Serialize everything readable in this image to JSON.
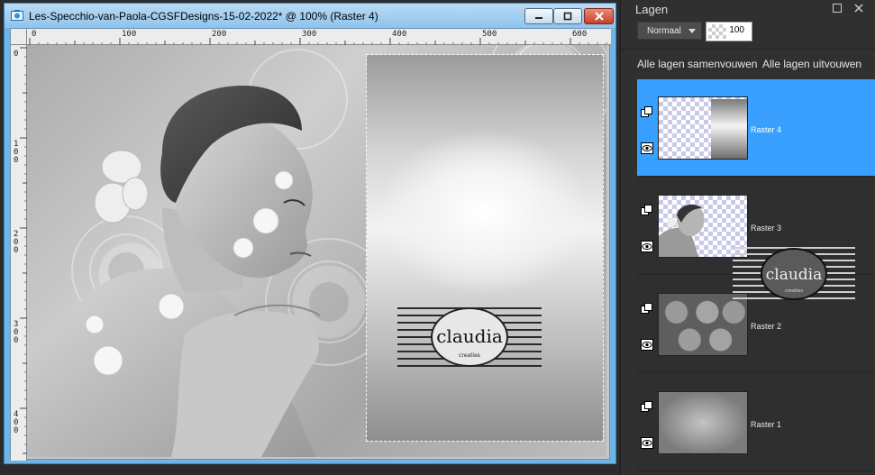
{
  "window": {
    "title": "Les-Specchio-van-Paola-CGSFDesigns-15-02-2022* @ 100% (Raster 4)",
    "buttons": [
      "minimize-icon",
      "maximize-icon",
      "close-icon"
    ]
  },
  "ruler": {
    "top_labels": [
      "0",
      "100",
      "200",
      "300",
      "400",
      "500",
      "600"
    ],
    "left_labels": [
      "0",
      "100",
      "200",
      "300",
      "400"
    ]
  },
  "canvas": {
    "watermark_text": "claudia",
    "watermark_sub": "creaties"
  },
  "layers_panel": {
    "title": "Lagen",
    "blend_mode": "Normaal",
    "opacity": "100",
    "collapse_all": "Alle lagen samenvouwen",
    "expand_all": "Alle lagen uitvouwen",
    "layers": [
      {
        "name": "Raster 4",
        "selected": true
      },
      {
        "name": "Raster 3",
        "selected": false
      },
      {
        "name": "Raster 2",
        "selected": false
      },
      {
        "name": "Raster 1",
        "selected": false
      }
    ]
  },
  "colors": {
    "selected_layer": "#3aa0ff",
    "panel_bg": "#303030",
    "window_frame": "#6fb4e6",
    "close_button": "#c9412c"
  }
}
